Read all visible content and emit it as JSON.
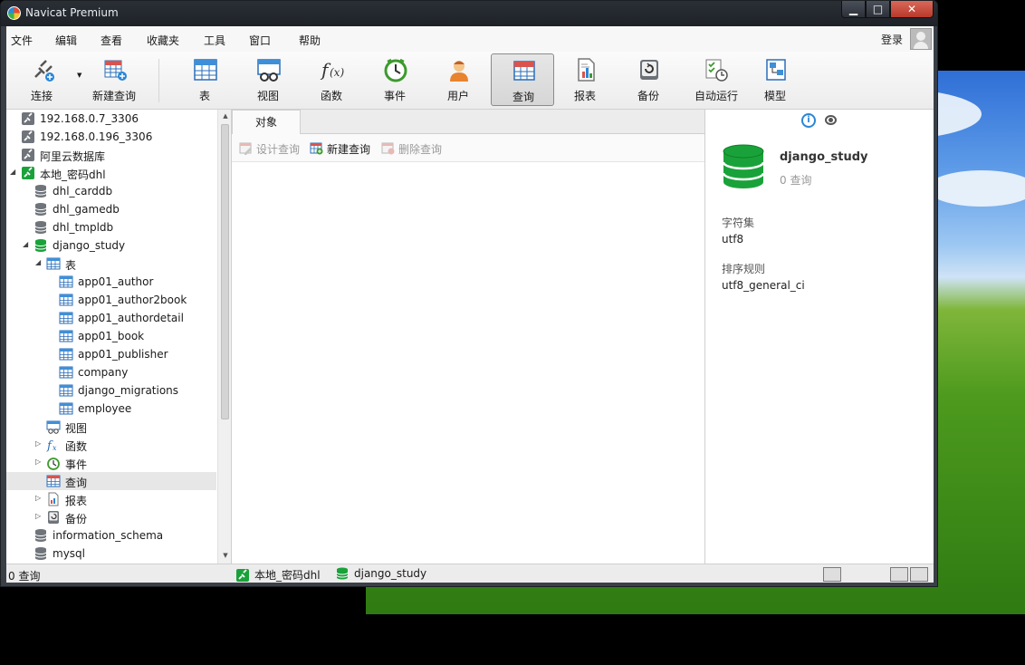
{
  "window": {
    "title": "Navicat Premium",
    "controls": {
      "minimize": "▁",
      "maximize": "□",
      "close": "✕"
    }
  },
  "menu": {
    "items": [
      "文件",
      "编辑",
      "查看",
      "收藏夹",
      "工具",
      "窗口",
      "帮助"
    ],
    "login": "登录"
  },
  "toolbar": {
    "items": [
      {
        "label": "连接",
        "icon": "connection-icon"
      },
      {
        "label": "新建查询",
        "icon": "new-query-icon"
      },
      {
        "label": "表",
        "icon": "table-icon"
      },
      {
        "label": "视图",
        "icon": "view-icon"
      },
      {
        "label": "函数",
        "icon": "function-icon"
      },
      {
        "label": "事件",
        "icon": "event-clock-icon"
      },
      {
        "label": "用户",
        "icon": "user-icon"
      },
      {
        "label": "查询",
        "icon": "query-icon",
        "active": true
      },
      {
        "label": "报表",
        "icon": "report-icon"
      },
      {
        "label": "备份",
        "icon": "backup-icon"
      },
      {
        "label": "自动运行",
        "icon": "automation-icon"
      },
      {
        "label": "模型",
        "icon": "model-icon"
      }
    ]
  },
  "nav": {
    "rows": [
      {
        "label": "192.168.0.7_3306",
        "level": 0,
        "icon": "connection-grey",
        "expander": ""
      },
      {
        "label": "192.168.0.196_3306",
        "level": 0,
        "icon": "connection-grey",
        "expander": ""
      },
      {
        "label": "阿里云数据库",
        "level": 0,
        "icon": "connection-grey",
        "expander": ""
      },
      {
        "label": "本地_密码dhl",
        "level": 0,
        "icon": "connection-green",
        "expander": "▲"
      },
      {
        "label": "dhl_carddb",
        "level": 1,
        "icon": "db-grey",
        "expander": ""
      },
      {
        "label": "dhl_gamedb",
        "level": 1,
        "icon": "db-grey",
        "expander": ""
      },
      {
        "label": "dhl_tmpldb",
        "level": 1,
        "icon": "db-grey",
        "expander": ""
      },
      {
        "label": "django_study",
        "level": 1,
        "icon": "db-green",
        "expander": "▲"
      },
      {
        "label": "表",
        "level": 2,
        "icon": "table",
        "expander": "▲"
      },
      {
        "label": "app01_author",
        "level": 3,
        "icon": "table",
        "expander": ""
      },
      {
        "label": "app01_author2book",
        "level": 3,
        "icon": "table",
        "expander": ""
      },
      {
        "label": "app01_authordetail",
        "level": 3,
        "icon": "table",
        "expander": ""
      },
      {
        "label": "app01_book",
        "level": 3,
        "icon": "table",
        "expander": ""
      },
      {
        "label": "app01_publisher",
        "level": 3,
        "icon": "table",
        "expander": ""
      },
      {
        "label": "company",
        "level": 3,
        "icon": "table",
        "expander": ""
      },
      {
        "label": "django_migrations",
        "level": 3,
        "icon": "table",
        "expander": ""
      },
      {
        "label": "employee",
        "level": 3,
        "icon": "table",
        "expander": ""
      },
      {
        "label": "视图",
        "level": 2,
        "icon": "view",
        "expander": ""
      },
      {
        "label": "函数",
        "level": 2,
        "icon": "function",
        "expander": "▷"
      },
      {
        "label": "事件",
        "level": 2,
        "icon": "event",
        "expander": "▷"
      },
      {
        "label": "查询",
        "level": 2,
        "icon": "query",
        "expander": "",
        "selected": true
      },
      {
        "label": "报表",
        "level": 2,
        "icon": "report",
        "expander": "▷"
      },
      {
        "label": "备份",
        "level": 2,
        "icon": "backup",
        "expander": "▷"
      },
      {
        "label": "information_schema",
        "level": 1,
        "icon": "db-grey",
        "expander": ""
      },
      {
        "label": "mysql",
        "level": 1,
        "icon": "db-grey",
        "expander": ""
      }
    ]
  },
  "center": {
    "tab": "对象",
    "actions": [
      {
        "label": "设计查询",
        "enabled": false
      },
      {
        "label": "新建查询",
        "enabled": true
      },
      {
        "label": "删除查询",
        "enabled": false
      }
    ]
  },
  "info": {
    "db_name": "django_study",
    "query_count": "0 查询",
    "charset_label": "字符集",
    "charset": "utf8",
    "collation_label": "排序规则",
    "collation": "utf8_general_ci"
  },
  "status": {
    "left": "0 查询",
    "connection": "本地_密码dhl",
    "database": "django_study"
  },
  "colors": {
    "accent_green": "#1aa23a",
    "selection": "#e7e7e7",
    "titlebar": "#1e2228"
  }
}
